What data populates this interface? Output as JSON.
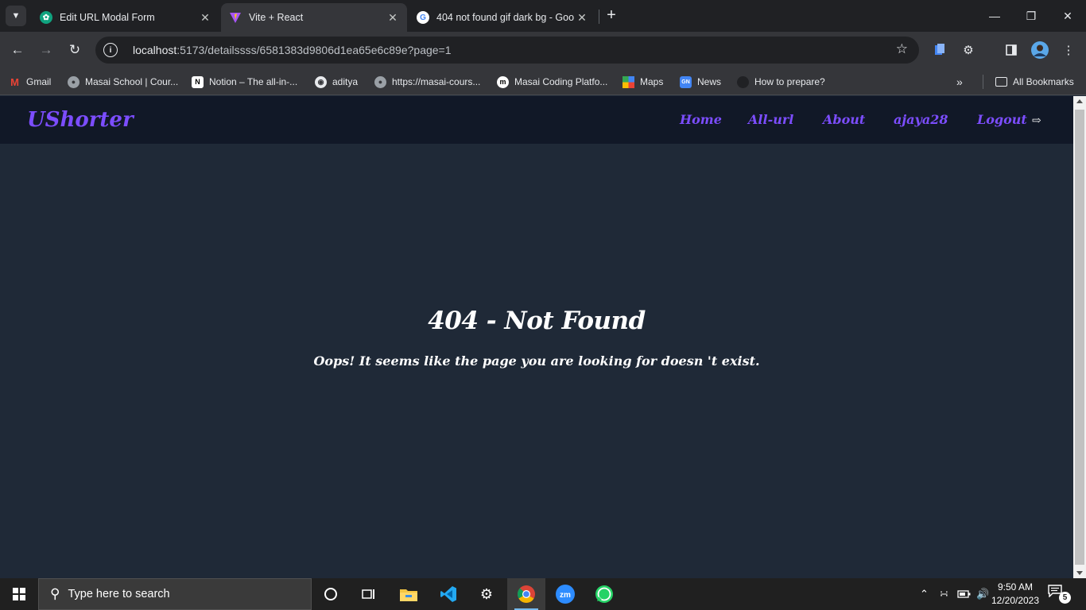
{
  "browser": {
    "tabs": [
      {
        "title": "Edit URL Modal Form",
        "icon": "chatgpt-icon",
        "active": false
      },
      {
        "title": "Vite + React",
        "icon": "vite-icon",
        "active": true
      },
      {
        "title": "404 not found gif dark bg - Goo",
        "icon": "google-icon",
        "active": false
      }
    ],
    "address": {
      "host": "localhost",
      "path": ":5173/detailssss/6581383d9806d1ea65e6c89e?page=1"
    },
    "bookmarks": [
      {
        "label": "Gmail",
        "icon": "gmail-icon"
      },
      {
        "label": "Masai School | Cour...",
        "icon": "globe-icon"
      },
      {
        "label": "Notion – The all-in-...",
        "icon": "notion-icon"
      },
      {
        "label": "aditya",
        "icon": "github-icon"
      },
      {
        "label": "https://masai-cours...",
        "icon": "globe-icon"
      },
      {
        "label": "Masai Coding Platfo...",
        "icon": "masai-icon"
      },
      {
        "label": "Maps",
        "icon": "maps-icon"
      },
      {
        "label": "News",
        "icon": "news-icon"
      },
      {
        "label": "How to prepare?",
        "icon": "bookmark-icon"
      }
    ],
    "overflow_label": "»",
    "all_bookmarks_label": "All Bookmarks"
  },
  "app": {
    "brand": "UShorter",
    "nav": [
      {
        "label": "Home"
      },
      {
        "label": "All-url"
      },
      {
        "label": "About"
      },
      {
        "label": "ajaya28"
      },
      {
        "label": "Logout"
      }
    ],
    "not_found": {
      "title": "404 - Not Found",
      "message": "Oops! It seems like the page you are looking for doesn 't exist."
    },
    "colors": {
      "accent": "#7c4dff",
      "nav_bg": "#111827",
      "page_bg": "#1f2937",
      "text": "#ffffff"
    }
  },
  "taskbar": {
    "search_placeholder": "Type here to search",
    "apps": [
      "cortana-icon",
      "task-view-icon",
      "file-explorer-icon",
      "vscode-icon",
      "settings-icon",
      "chrome-icon",
      "zoom-icon",
      "whatsapp-icon"
    ],
    "time": "9:50 AM",
    "date": "12/20/2023",
    "notification_count": "5"
  }
}
